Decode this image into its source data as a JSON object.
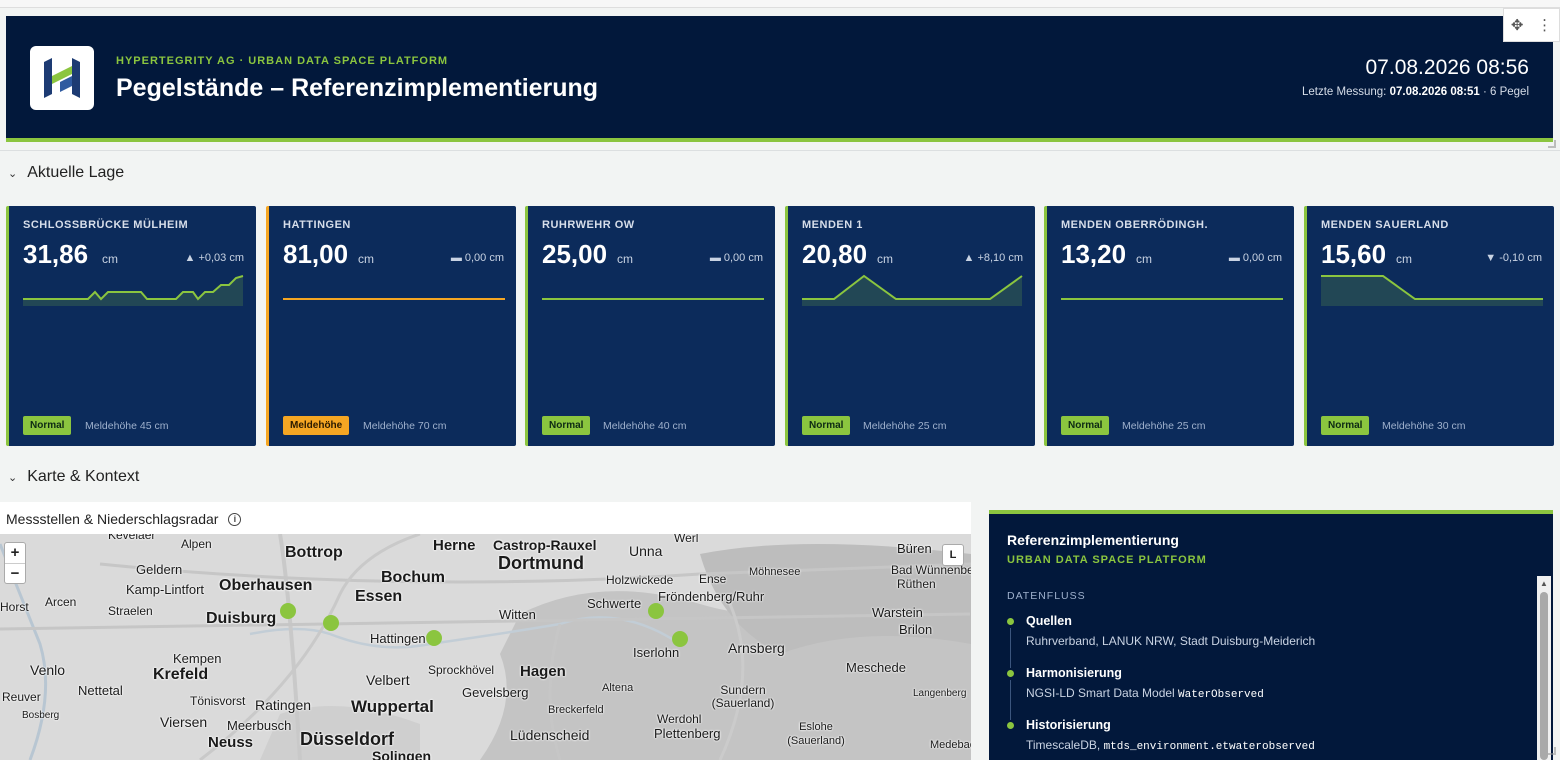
{
  "header": {
    "kicker": "HYPERTEGRITY AG · URBAN DATA SPACE PLATFORM",
    "title": "Pegelstände – Referenzimplementierung",
    "datetime": "07.08.2026 08:56",
    "last_label": "Letzte Messung:",
    "last_value": "07.08.2026 08:51",
    "count": "· 6 Pegel"
  },
  "sections": {
    "current": "Aktuelle Lage",
    "map": "Karte & Kontext"
  },
  "cards": [
    {
      "station": "SCHLOSSBRÜCKE MÜLHEIM",
      "value": "31,86",
      "unit": "cm",
      "delta": "▲ +0,03 cm",
      "status": "Normal",
      "threshold": "Meldehöhe 45 cm"
    },
    {
      "station": "HATTINGEN",
      "value": "81,00",
      "unit": "cm",
      "delta": "▬ 0,00 cm",
      "status": "Meldehöhe",
      "threshold": "Meldehöhe 70 cm"
    },
    {
      "station": "RUHRWEHR OW",
      "value": "25,00",
      "unit": "cm",
      "delta": "▬ 0,00 cm",
      "status": "Normal",
      "threshold": "Meldehöhe 40 cm"
    },
    {
      "station": "MENDEN 1",
      "value": "20,80",
      "unit": "cm",
      "delta": "▲ +8,10 cm",
      "status": "Normal",
      "threshold": "Meldehöhe 25 cm"
    },
    {
      "station": "MENDEN OBERRÖDINGH.",
      "value": "13,20",
      "unit": "cm",
      "delta": "▬ 0,00 cm",
      "status": "Normal",
      "threshold": "Meldehöhe 25 cm"
    },
    {
      "station": "MENDEN SAUERLAND",
      "value": "15,60",
      "unit": "cm",
      "delta": "▼ -0,10 cm",
      "status": "Normal",
      "threshold": "Meldehöhe 30 cm"
    }
  ],
  "map": {
    "title": "Messstellen & Niederschlagsradar",
    "zoom_in": "+",
    "zoom_out": "−",
    "layer_label": "L",
    "cities": [
      "Bottrop",
      "Herne",
      "Castrop-Rauxel",
      "Unna",
      "Werl",
      "Büren",
      "Dortmund",
      "Holzwickede",
      "Ense",
      "Möhnesee",
      "Bad Wünnenberg",
      "Rüthen",
      "Oberhausen",
      "Bochum",
      "Geldern",
      "Kamp-Lintfort",
      "Essen",
      "Straelen",
      "Horst",
      "Arcen",
      "Duisburg",
      "Witten",
      "Schwerte",
      "Fröndenberg/Ruhr",
      "Warstein",
      "Brilon",
      "Hattingen",
      "Kempen",
      "Iserlohn",
      "Arnsberg",
      "Meschede",
      "Krefeld",
      "Velbert",
      "Sprockhövel",
      "Hagen",
      "Venlo",
      "Nettetal",
      "Tönisvorst",
      "Ratingen",
      "Gevelsberg",
      "Altena",
      "Sundern (Sauerland)",
      "Wuppertal",
      "Viersen",
      "Meerbusch",
      "Breckerfeld",
      "Werdohl",
      "Neuss",
      "Düsseldorf",
      "Lüdenscheid",
      "Plettenberg",
      "Eslohe (Sauerland)",
      "Alpen",
      "Reuver",
      "Bosberg",
      "Kevelaer",
      "Solingen",
      "Langenberg",
      "Medebach"
    ]
  },
  "info": {
    "heading": "Referenzimplementierung",
    "subheading": "URBAN DATA SPACE PLATFORM",
    "flow_label": "DATENFLUSS",
    "flow": [
      {
        "title": "Quellen",
        "desc": "Ruhrverband, LANUK NRW, Stadt Duisburg-Meiderich",
        "code": ""
      },
      {
        "title": "Harmonisierung",
        "desc": "NGSI-LD Smart Data Model ",
        "code": "WaterObserved"
      },
      {
        "title": "Historisierung",
        "desc": "TimescaleDB, ",
        "code": "mtds_environment.etwaterobserved"
      }
    ]
  },
  "colors": {
    "navy": "#02183b",
    "card": "#0c2b5b",
    "accent": "#8bc53f",
    "warn": "#f5a623"
  }
}
